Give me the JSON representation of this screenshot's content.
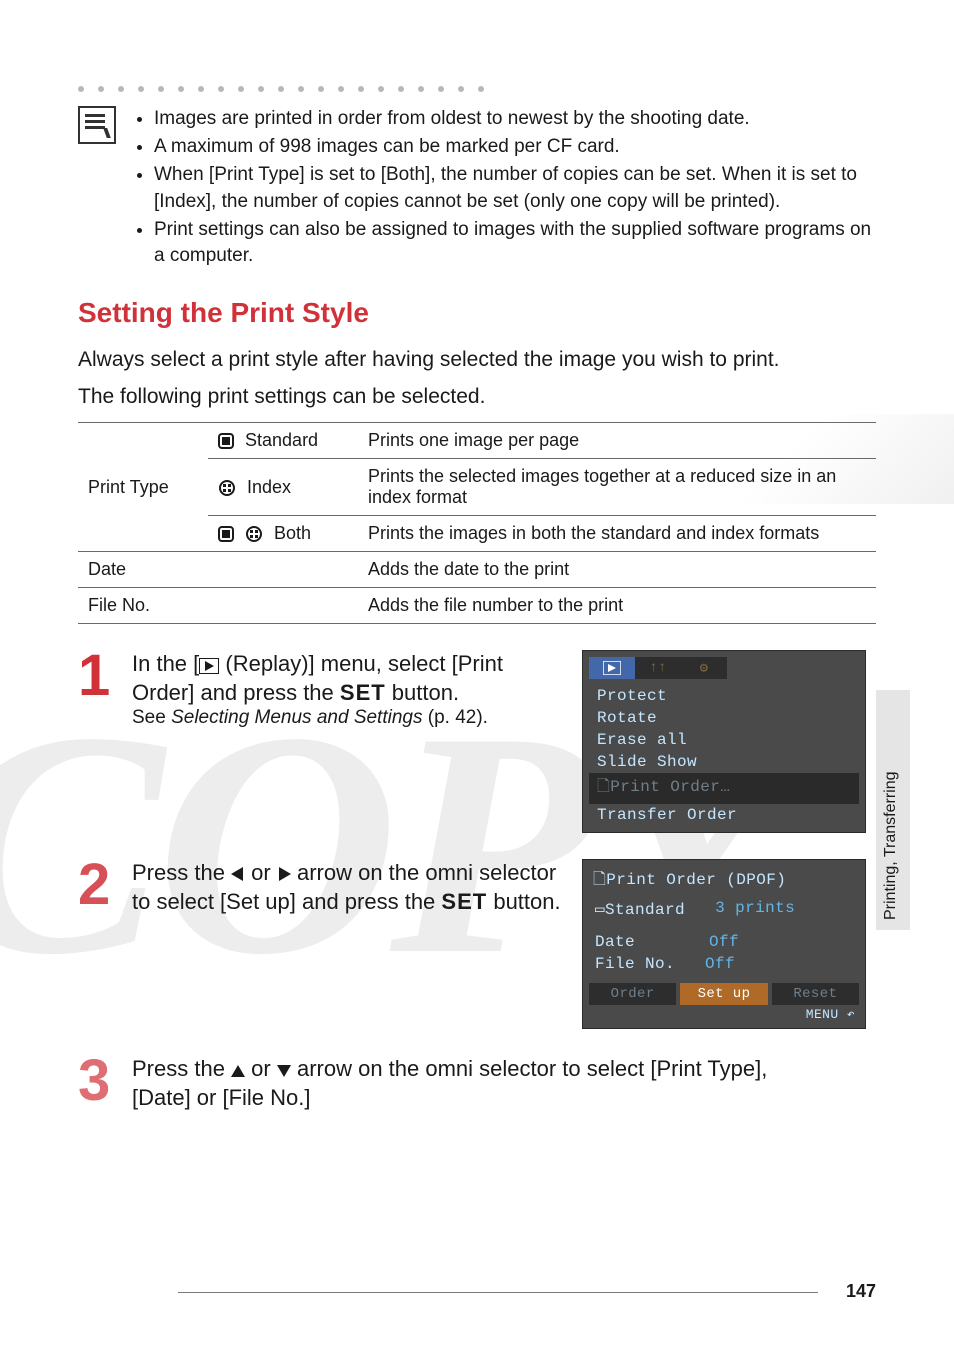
{
  "notes": [
    "Images are printed in order from oldest to newest by the shooting date.",
    "A maximum of 998 images can be marked per CF card.",
    "When [Print Type] is set to [Both], the number of copies can be set. When it is set to [Index], the number of copies cannot be set (only one copy will be printed).",
    "Print settings can also be assigned to images with the supplied software programs on a computer."
  ],
  "section_title": "Setting the Print Style",
  "lead1": "Always select a print style after having selected the image you wish to print.",
  "lead2": "The following print settings can be selected.",
  "table": {
    "group": "Print Type",
    "rows": [
      {
        "icon": "standard",
        "label": "Standard",
        "desc": "Prints one image per page"
      },
      {
        "icon": "index",
        "label": "Index",
        "desc": "Prints the selected images together at a reduced size in an index format"
      },
      {
        "icon": "both",
        "label": "Both",
        "desc": "Prints the images in both the standard and index formats"
      }
    ],
    "date_label": "Date",
    "date_desc": "Adds the date to the print",
    "fileno_label": "File No.",
    "fileno_desc": "Adds the file number to the print"
  },
  "steps": {
    "s1": {
      "num": "1",
      "title_a": "In the [",
      "title_b": " (Replay)] menu, select [Print Order] and press the ",
      "title_c": " button.",
      "set_label": "SET",
      "sub_pre": "See ",
      "sub_link": "Selecting Menus and Settings",
      "sub_post": " (p. 42).",
      "lcd": {
        "items": [
          "Protect",
          "Rotate",
          "Erase all",
          "Slide Show",
          "Print Order…",
          "Transfer Order"
        ],
        "highlight_index": 4
      }
    },
    "s2": {
      "num": "2",
      "title_a": "Press the ",
      "title_b": " or ",
      "title_c": " arrow on the omni selector to select [Set up] and press the ",
      "title_d": " button.",
      "set_label": "SET",
      "lcd": {
        "title": "Print Order (DPOF)",
        "mode_label": "Standard",
        "mode_value": "3 prints",
        "date_label": "Date",
        "date_value": "Off",
        "file_label": "File No.",
        "file_value": "Off",
        "buttons": [
          "Order",
          "Set up",
          "Reset"
        ],
        "selected_button": 1,
        "menu": "MENU"
      }
    },
    "s3": {
      "num": "3",
      "title_a": "Press the ",
      "title_b": " or ",
      "title_c": " arrow on the omni selector to select [Print Type], [Date] or [File No.]"
    }
  },
  "side_tab": "Printing, Transferring",
  "page_number": "147",
  "watermark": "COPY"
}
